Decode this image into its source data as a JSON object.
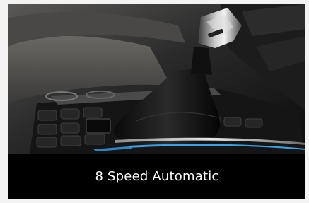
{
  "caption": "8 Speed Automatic",
  "photo": {
    "icon": "gear-shifter-photo",
    "colors": {
      "background": "#000000",
      "caption_text": "#ffffff",
      "accent_blue": "#3aa0e0"
    }
  }
}
